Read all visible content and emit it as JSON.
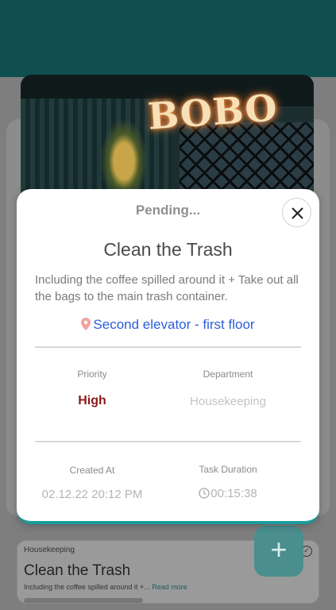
{
  "background": {
    "photo_sign_text": "BOBO",
    "bottom_card": {
      "department": "Housekeeping",
      "title": "Clean the Trash",
      "description": "Including the coffee spilled around it +...",
      "read_more": "Read more"
    },
    "fab_icon": "plus-icon"
  },
  "modal": {
    "status": "Pending...",
    "title": "Clean the Trash",
    "description": "Including the coffee spilled around it + Take out all the bags to the main trash container.",
    "location": "Second elevator - first floor",
    "priority_label": "Priority",
    "priority_value": "High",
    "department_label": "Department",
    "department_value": "Housekeeping",
    "created_label": "Created At",
    "created_value": "02.12.22 20:12 PM",
    "duration_label": "Task Duration",
    "duration_value": "00:15:38"
  },
  "colors": {
    "header": "#0f4f50",
    "accent": "#1a9b9b",
    "location_link": "#2b5fd9",
    "priority_high": "#8b1a1a"
  }
}
